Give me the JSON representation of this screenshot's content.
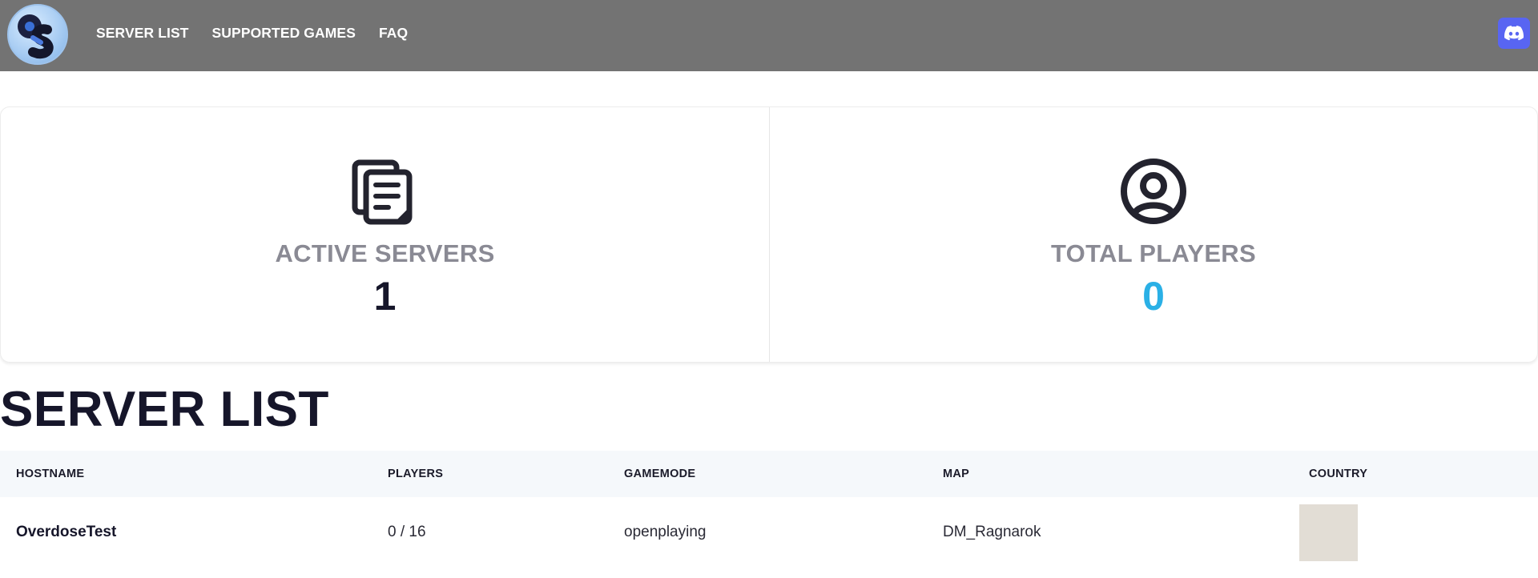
{
  "nav": {
    "items": [
      "SERVER LIST",
      "SUPPORTED GAMES",
      "FAQ"
    ]
  },
  "logo": {
    "icon": "os-logo"
  },
  "discord": {
    "icon": "discord-icon",
    "color": "#5865f2"
  },
  "stats": {
    "active_servers": {
      "label": "ACTIVE SERVERS",
      "value": "1",
      "icon": "documents-icon"
    },
    "total_players": {
      "label": "TOTAL PLAYERS",
      "value": "0",
      "icon": "user-circle-icon",
      "value_color": "#2ab0e6"
    }
  },
  "server_list": {
    "title": "SERVER LIST",
    "columns": [
      "HOSTNAME",
      "PLAYERS",
      "GAMEMODE",
      "MAP",
      "COUNTRY"
    ],
    "rows": [
      {
        "hostname": "OverdoseTest",
        "players": "0 / 16",
        "gamemode": "openplaying",
        "map": "DM_Ragnarok"
      }
    ]
  }
}
